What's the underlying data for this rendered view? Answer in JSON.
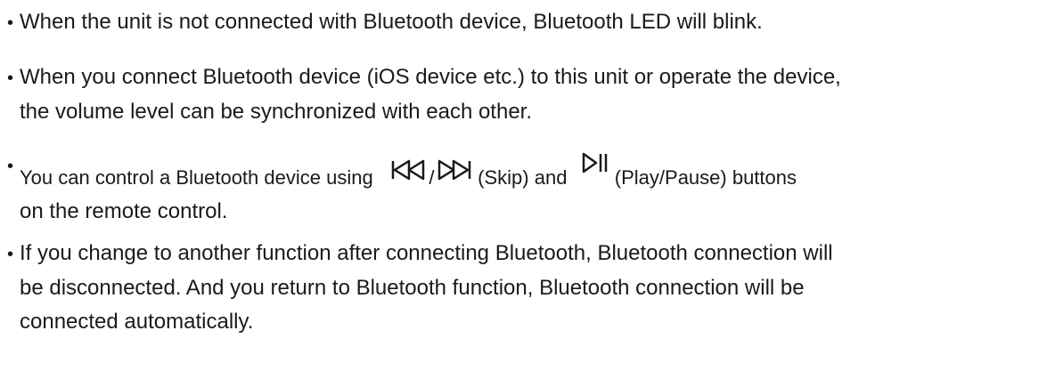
{
  "items": [
    {
      "line1": "When the unit is not connected with Bluetooth device, Bluetooth LED will blink."
    },
    {
      "line1": "When you connect Bluetooth device (iOS device etc.) to this unit or operate the device,",
      "line2": "the volume level can be synchronized with each other."
    },
    {
      "part1": "You can control a Bluetooth device using",
      "slash": "/",
      "skip_label": "(Skip) and",
      "playpause_label": "(Play/Pause) buttons",
      "line2": "on the remote control.",
      "icons": [
        "skip-back-icon",
        "skip-forward-icon",
        "play-pause-icon"
      ]
    },
    {
      "line1": "If you change to another function after connecting Bluetooth, Bluetooth connection will",
      "line2": "be disconnected. And you return to Bluetooth function, Bluetooth connection will be",
      "line3": "connected automatically."
    }
  ],
  "bullet": "•"
}
